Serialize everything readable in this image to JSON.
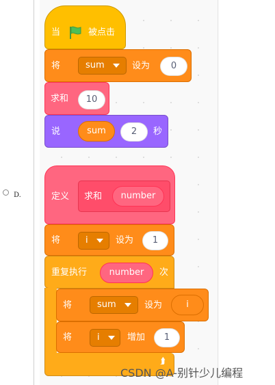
{
  "option": {
    "label": "D."
  },
  "script1": {
    "hat": {
      "prefix": "当",
      "suffix": "被点击",
      "icon": "green-flag-icon"
    },
    "set_var": {
      "label": "将",
      "variable": "sum",
      "middle": "设为",
      "value": "0"
    },
    "call": {
      "label": "求和",
      "arg": "10"
    },
    "say": {
      "label": "说",
      "variable": "sum",
      "secs": "2",
      "unit": "秒"
    }
  },
  "script2": {
    "define": {
      "label": "定义",
      "block_name": "求和",
      "param": "number"
    },
    "set_i": {
      "label": "将",
      "variable": "i",
      "middle": "设为",
      "value": "1"
    },
    "repeat": {
      "label": "重复执行",
      "times": "number",
      "unit": "次"
    },
    "set_sum": {
      "label": "将",
      "variable": "sum",
      "middle": "设为",
      "value": "i"
    },
    "change_i": {
      "label": "将",
      "variable": "i",
      "middle": "增加",
      "value": "1"
    }
  },
  "watermark": "CSDN @A-别针少儿编程",
  "colors": {
    "events": "#ffbf00",
    "variables": "#ff8c1a",
    "my_blocks": "#ff6680",
    "looks": "#9966ff",
    "control": "#ffab19"
  }
}
